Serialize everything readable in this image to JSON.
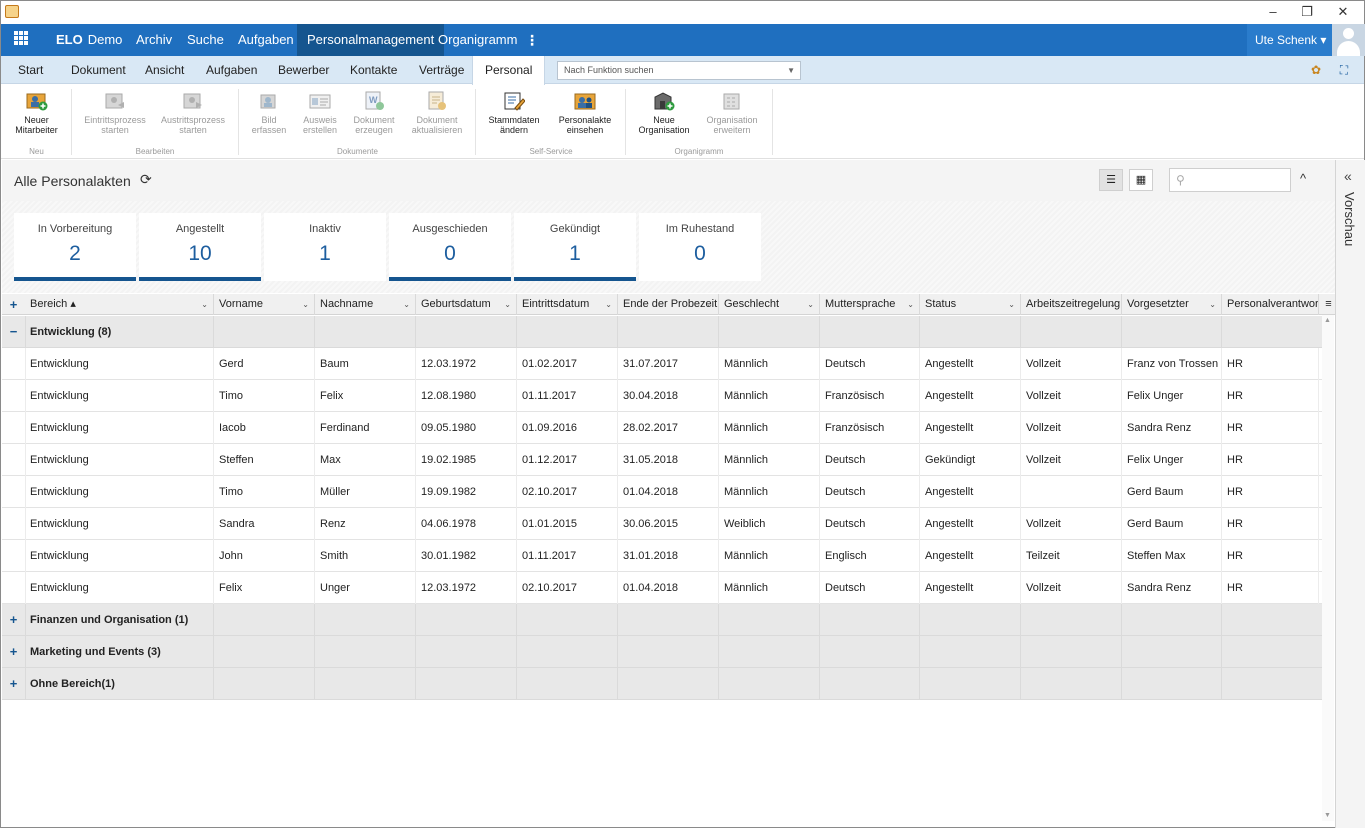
{
  "window": {
    "minimize": "–",
    "restore": "❐",
    "close": "✕"
  },
  "nav": {
    "brand_bold": "ELO",
    "brand_name": "Demo",
    "items": [
      "Archiv",
      "Suche",
      "Aufgaben",
      "Personalmanagement",
      "Organigramm"
    ],
    "active": "Personalmanagement",
    "kebab": "⋮",
    "user": "Ute Schenk ▾"
  },
  "ribbon_tabs": {
    "items": [
      "Start",
      "Dokument",
      "Ansicht",
      "Aufgaben",
      "Bewerber",
      "Kontakte",
      "Verträge",
      "Personal"
    ],
    "active": "Personal",
    "function_search_placeholder": "Nach Funktion suchen"
  },
  "ribbon": {
    "groups": [
      {
        "label": "Neu",
        "buttons": [
          {
            "line1": "Neuer",
            "line2": "Mitarbeiter",
            "enabled": true,
            "icon": "new-employee-icon"
          }
        ]
      },
      {
        "label": "Bearbeiten",
        "buttons": [
          {
            "line1": "Eintrittsprozess",
            "line2": "starten",
            "enabled": false,
            "icon": "entry-process-icon"
          },
          {
            "line1": "Austrittsprozess",
            "line2": "starten",
            "enabled": false,
            "icon": "exit-process-icon"
          }
        ]
      },
      {
        "label": "Dokumente",
        "buttons": [
          {
            "line1": "Bild",
            "line2": "erfassen",
            "enabled": false,
            "icon": "capture-photo-icon"
          },
          {
            "line1": "Ausweis",
            "line2": "erstellen",
            "enabled": false,
            "icon": "id-card-icon"
          },
          {
            "line1": "Dokument",
            "line2": "erzeugen",
            "enabled": false,
            "icon": "word-document-icon"
          },
          {
            "line1": "Dokument",
            "line2": "aktualisieren",
            "enabled": false,
            "icon": "update-document-icon"
          }
        ]
      },
      {
        "label": "Self-Service",
        "buttons": [
          {
            "line1": "Stammdaten",
            "line2": "ändern",
            "enabled": true,
            "icon": "edit-master-data-icon"
          },
          {
            "line1": "Personalakte",
            "line2": "einsehen",
            "enabled": true,
            "icon": "personnel-file-icon"
          }
        ]
      },
      {
        "label": "Organigramm",
        "buttons": [
          {
            "line1": "Neue",
            "line2": "Organisation",
            "enabled": true,
            "icon": "new-organization-icon"
          },
          {
            "line1": "Organisation",
            "line2": "erweitern",
            "enabled": false,
            "icon": "extend-organization-icon"
          }
        ]
      }
    ]
  },
  "content": {
    "title": "Alle Personalakten",
    "refresh_icon": "⟳",
    "collapse_icon": "^",
    "search_icon": "⚲"
  },
  "tiles": [
    {
      "label": "In Vorbereitung",
      "value": "2",
      "selected": true
    },
    {
      "label": "Angestellt",
      "value": "10",
      "selected": true
    },
    {
      "label": "Inaktiv",
      "value": "1",
      "selected": false
    },
    {
      "label": "Ausgeschieden",
      "value": "0",
      "selected": true
    },
    {
      "label": "Gekündigt",
      "value": "1",
      "selected": true
    },
    {
      "label": "Im Ruhestand",
      "value": "0",
      "selected": false
    }
  ],
  "grid": {
    "columns": [
      "Bereich ▴",
      "Vorname",
      "Nachname",
      "Geburtsdatum",
      "Eintrittsdatum",
      "Ende der Probezeit",
      "Geschlecht",
      "Muttersprache",
      "Status",
      "Arbeitszeitregelung",
      "Vorgesetzter",
      "Personalverantwor..."
    ],
    "groups": [
      {
        "label": "Entwicklung (8)",
        "expanded": true,
        "rows": [
          [
            "Entwicklung",
            "Gerd",
            "Baum",
            "12.03.1972",
            "01.02.2017",
            "31.07.2017",
            "Männlich",
            "Deutsch",
            "Angestellt",
            "Vollzeit",
            "Franz von Trossen",
            "HR"
          ],
          [
            "Entwicklung",
            "Timo",
            "Felix",
            "12.08.1980",
            "01.11.2017",
            "30.04.2018",
            "Männlich",
            "Französisch",
            "Angestellt",
            "Vollzeit",
            "Felix Unger",
            "HR"
          ],
          [
            "Entwicklung",
            "Iacob",
            "Ferdinand",
            "09.05.1980",
            "01.09.2016",
            "28.02.2017",
            "Männlich",
            "Französisch",
            "Angestellt",
            "Vollzeit",
            "Sandra Renz",
            "HR"
          ],
          [
            "Entwicklung",
            "Steffen",
            "Max",
            "19.02.1985",
            "01.12.2017",
            "31.05.2018",
            "Männlich",
            "Deutsch",
            "Gekündigt",
            "Vollzeit",
            "Felix Unger",
            "HR"
          ],
          [
            "Entwicklung",
            "Timo",
            "Müller",
            "19.09.1982",
            "02.10.2017",
            "01.04.2018",
            "Männlich",
            "Deutsch",
            "Angestellt",
            "",
            "Gerd Baum",
            "HR"
          ],
          [
            "Entwicklung",
            "Sandra",
            "Renz",
            "04.06.1978",
            "01.01.2015",
            "30.06.2015",
            "Weiblich",
            "Deutsch",
            "Angestellt",
            "Vollzeit",
            "Gerd Baum",
            "HR"
          ],
          [
            "Entwicklung",
            "John",
            "Smith",
            "30.01.1982",
            "01.11.2017",
            "31.01.2018",
            "Männlich",
            "Englisch",
            "Angestellt",
            "Teilzeit",
            "Steffen Max",
            "HR"
          ],
          [
            "Entwicklung",
            "Felix",
            "Unger",
            "12.03.1972",
            "02.10.2017",
            "01.04.2018",
            "Männlich",
            "Deutsch",
            "Angestellt",
            "Vollzeit",
            "Sandra Renz",
            "HR"
          ]
        ]
      },
      {
        "label": "Finanzen und Organisation (1)",
        "expanded": false,
        "rows": []
      },
      {
        "label": "Marketing und Events (3)",
        "expanded": false,
        "rows": []
      },
      {
        "label": "Ohne Bereich(1)",
        "expanded": false,
        "rows": []
      }
    ]
  },
  "preview": {
    "label": "Vorschau",
    "toggle": "«"
  }
}
